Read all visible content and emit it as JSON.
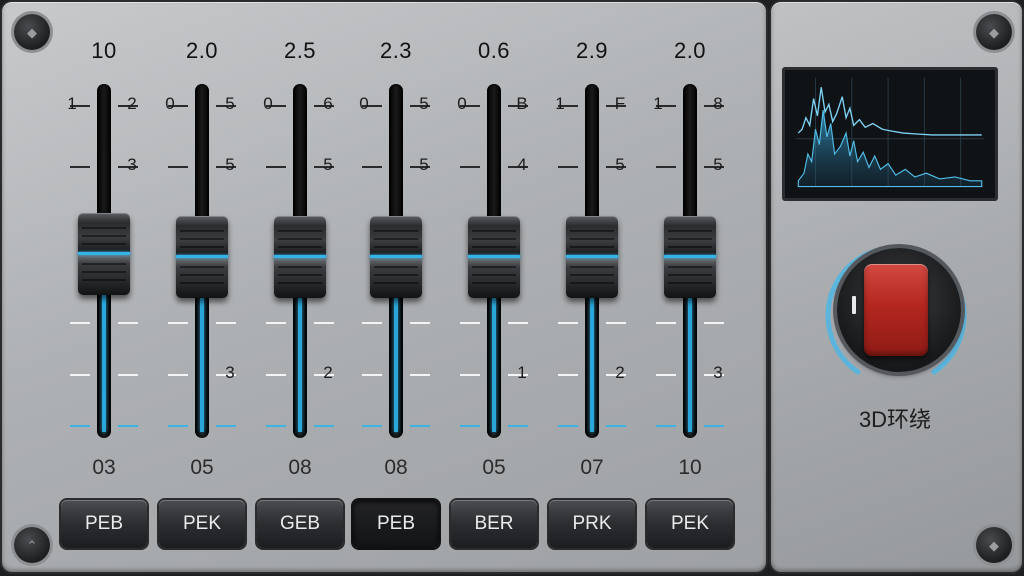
{
  "channels": [
    {
      "value": "10",
      "freq": "03",
      "button": "PEB",
      "ticks": [
        "1",
        "2",
        "3"
      ],
      "active": false,
      "level": 0.62
    },
    {
      "value": "2.0",
      "freq": "05",
      "button": "PEK",
      "ticks": [
        "0",
        "5",
        "5",
        "3"
      ],
      "active": false,
      "level": 0.61
    },
    {
      "value": "2.5",
      "freq": "08",
      "button": "GEB",
      "ticks": [
        "0",
        "6",
        "5",
        "2"
      ],
      "active": false,
      "level": 0.61
    },
    {
      "value": "2.3",
      "freq": "08",
      "button": "PEB",
      "ticks": [
        "0",
        "5",
        "5"
      ],
      "active": true,
      "level": 0.61
    },
    {
      "value": "0.6",
      "freq": "05",
      "button": "BER",
      "ticks": [
        "0",
        "B",
        "4",
        "1"
      ],
      "active": false,
      "level": 0.61
    },
    {
      "value": "2.9",
      "freq": "07",
      "button": "PRK",
      "ticks": [
        "1",
        "F",
        "5",
        "2"
      ],
      "active": false,
      "level": 0.61
    },
    {
      "value": "2.0",
      "freq": "10",
      "button": "PEK",
      "ticks": [
        "1",
        "8",
        "5",
        "3"
      ],
      "active": false,
      "level": 0.61
    }
  ],
  "surround": {
    "label": "3D环绕",
    "state": "on"
  },
  "colors": {
    "accent": "#2aa6d8",
    "switch": "#b3271f"
  }
}
